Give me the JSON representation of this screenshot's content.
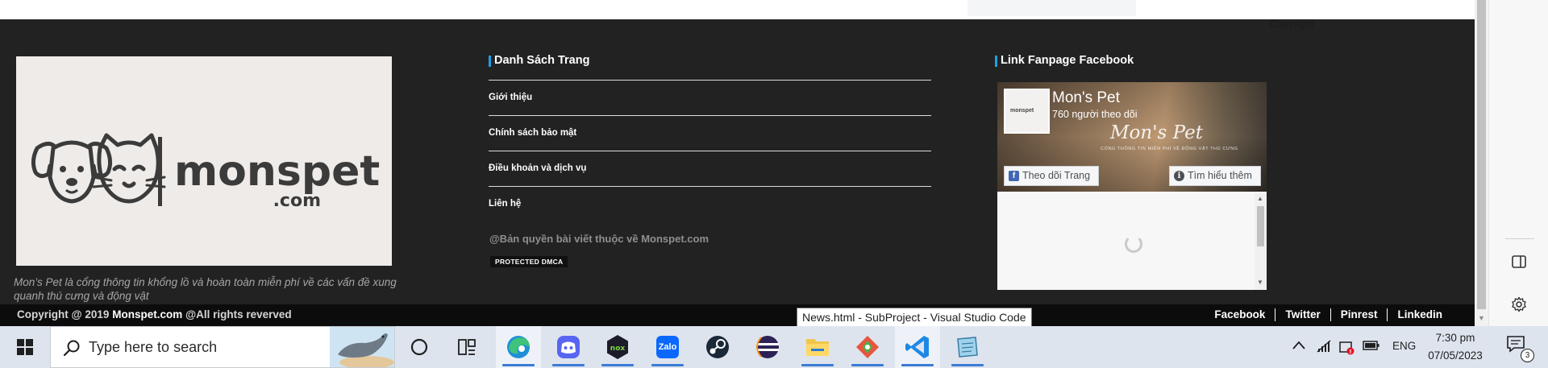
{
  "top": {
    "copyright_word": "Copyright"
  },
  "footer": {
    "about": "Mon’s Pet là cổng thông tin khổng lồ và hoàn toàn miễn phí về các vấn đề xung quanh thú cưng và động vật",
    "pages_title": "Danh Sách Trang",
    "pages": [
      {
        "label": "Giới thiệu"
      },
      {
        "label": "Chính sách bảo mật"
      },
      {
        "label": "Điều khoản và dịch vụ"
      },
      {
        "label": "Liên hệ"
      }
    ],
    "rights_note": "@Bản quyền bài viết thuộc về Monspet.com",
    "dmca_badge": "PROTECTED DMCA",
    "fanpage_title": "Link Fanpage Facebook",
    "logo_text": "monspet",
    "logo_suffix": ".com"
  },
  "fb_widget": {
    "page_name": "Mon's Pet",
    "followers": "760 người theo dõi",
    "cover_script": "Mon's Pet",
    "cover_tagline": "CỔNG THÔNG TIN MIỄN PHÍ VỀ ĐỘNG VẬT THÚ CƯNG",
    "thumb_text": "monspet",
    "follow_label": "Theo dõi Trang",
    "learn_label": "Tìm hiểu thêm"
  },
  "bottombar": {
    "copyright_prefix": "Copyright @ 2019 ",
    "site": "Monspet.com",
    "rights": " @All rights reverved",
    "social": [
      "Facebook",
      "Twitter",
      "Pinrest",
      "Linkedin"
    ]
  },
  "tooltip": "News.html - SubProject - Visual Studio Code",
  "taskbar": {
    "search_placeholder": "Type here to search",
    "apps": [
      {
        "name": "cortana-icon"
      },
      {
        "name": "task-view-icon"
      },
      {
        "name": "edge-icon"
      },
      {
        "name": "discord-icon"
      },
      {
        "name": "nox-icon"
      },
      {
        "name": "zalo-icon",
        "text": "Zalo"
      },
      {
        "name": "steam-icon"
      },
      {
        "name": "eclipse-icon"
      },
      {
        "name": "file-explorer-icon"
      },
      {
        "name": "git-icon"
      },
      {
        "name": "vscode-icon"
      },
      {
        "name": "notepad-icon"
      }
    ],
    "lang": "ENG",
    "time": "7:30 pm",
    "date": "07/05/2023",
    "notification_count": "3"
  },
  "colors": {
    "footer_bg": "#222222",
    "accent": "#1e9fe6",
    "bottombar_bg": "#0c0c0c",
    "taskbar_bg": "#dde4ee"
  }
}
